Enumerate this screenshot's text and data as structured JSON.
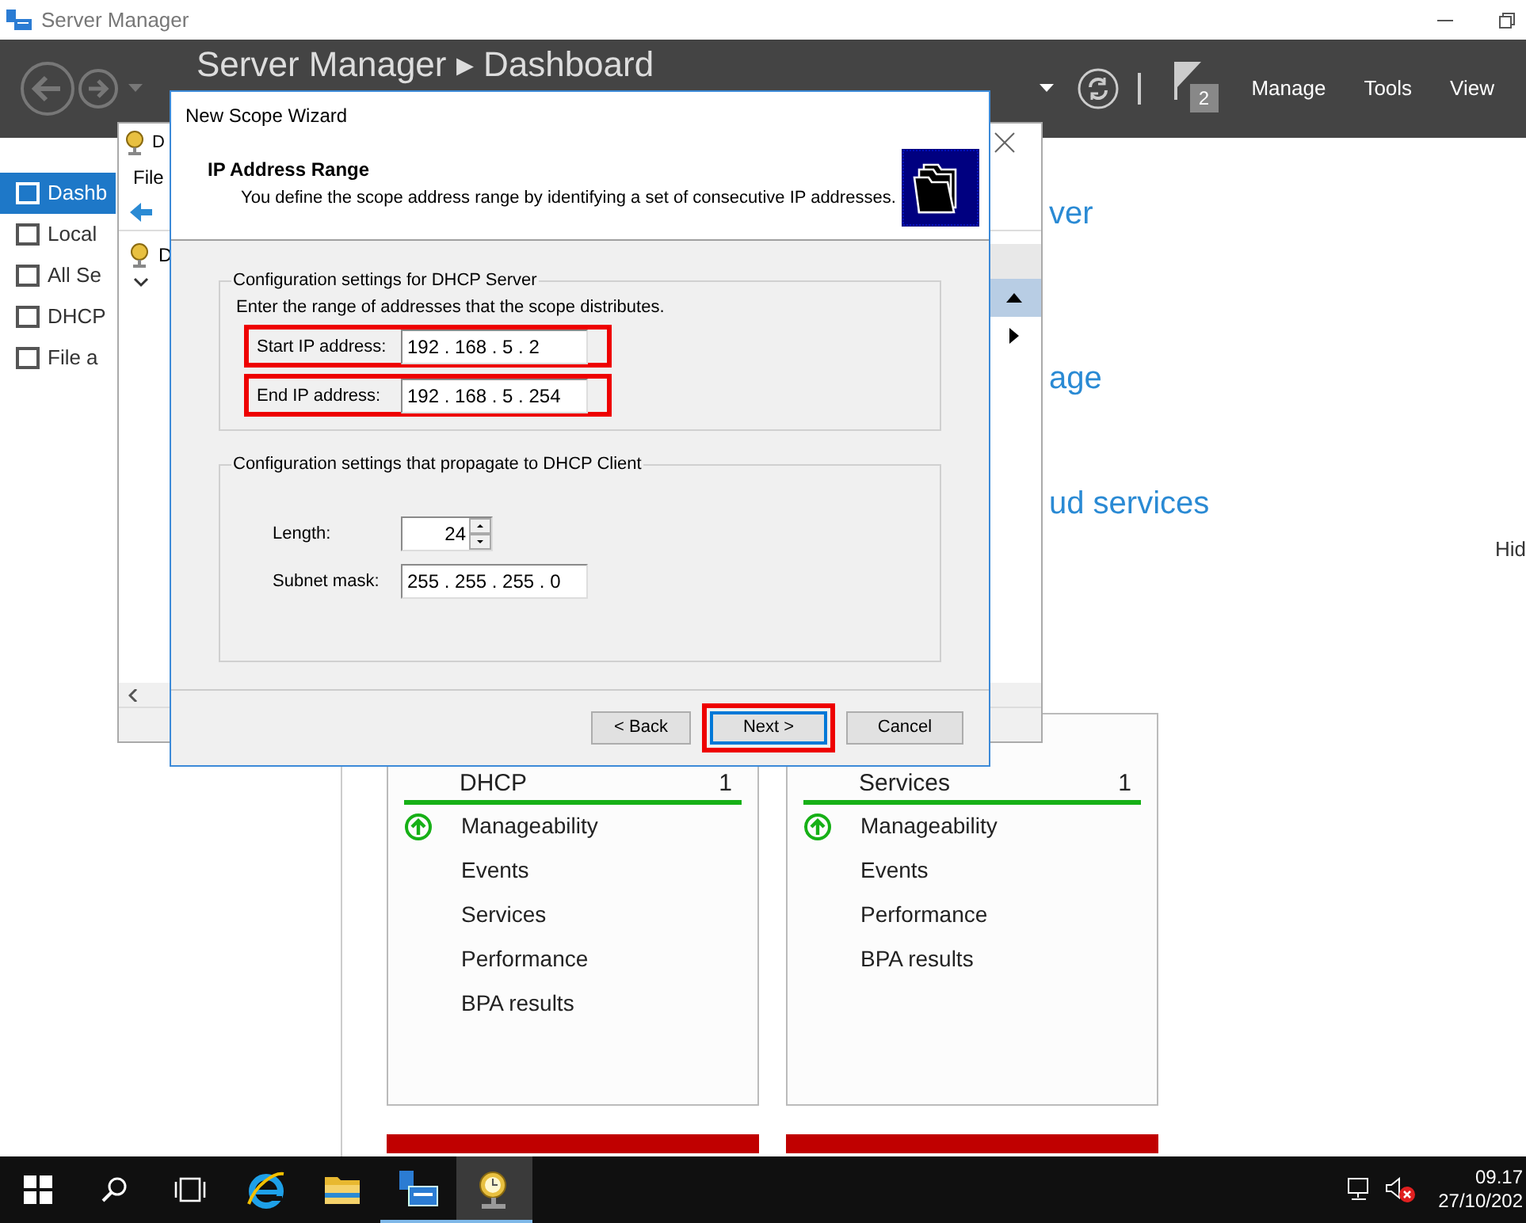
{
  "server_manager": {
    "title": "Server Manager",
    "breadcrumb": "Server Manager ▸ Dashboard",
    "notification_count": "2",
    "menu": [
      "Manage",
      "Tools",
      "View"
    ],
    "sidebar": [
      {
        "label": "Dashb",
        "selected": true
      },
      {
        "label": "Local",
        "selected": false
      },
      {
        "label": "All Se",
        "selected": false
      },
      {
        "label": "DHCP",
        "selected": false
      },
      {
        "label": "File a",
        "selected": false
      }
    ],
    "headings": [
      "ver",
      "age",
      "ud services"
    ],
    "hide_link": "Hid",
    "tiles": [
      {
        "title": "DHCP",
        "count": "1",
        "items": [
          {
            "label": "Manageability",
            "kind": "status"
          },
          {
            "label": "Events",
            "kind": "plain"
          },
          {
            "label": "Services",
            "kind": "plain"
          },
          {
            "label": "Performance",
            "kind": "plain"
          },
          {
            "label": "BPA results",
            "kind": "plain"
          }
        ]
      },
      {
        "title": "Services",
        "count": "1",
        "items": [
          {
            "label": "Manageability",
            "kind": "status"
          },
          {
            "label": "Events",
            "kind": "plain"
          },
          {
            "label": "Performance",
            "kind": "plain"
          },
          {
            "label": "BPA results",
            "kind": "plain"
          }
        ]
      }
    ]
  },
  "dhcp_console": {
    "title": "D",
    "menu": [
      "File"
    ],
    "tree_root": "D"
  },
  "wizard": {
    "title": "New Scope Wizard",
    "heading": "IP Address Range",
    "subtitle": "You define the scope address range by identifying a set of consecutive IP addresses.",
    "groups": [
      {
        "legend": "Configuration settings for DHCP Server",
        "intro": "Enter the range of addresses that the scope distributes.",
        "fields": [
          {
            "kind": "ip",
            "label": "Start IP address:",
            "value": "192 . 168 . 5 . 2",
            "highlighted": true
          },
          {
            "kind": "ip",
            "label": "End IP address:",
            "value": "192 . 168 . 5 . 254",
            "highlighted": true
          }
        ]
      },
      {
        "legend": "Configuration settings that propagate to DHCP Client",
        "fields": [
          {
            "kind": "spinner",
            "label": "Length:",
            "value": "24",
            "highlighted": false
          },
          {
            "kind": "ip",
            "label": "Subnet mask:",
            "value": "255 . 255 . 255 . 0",
            "highlighted": false
          }
        ]
      }
    ],
    "buttons": [
      {
        "label": "< Back",
        "default": false,
        "highlighted": false
      },
      {
        "label": "Next >",
        "default": true,
        "highlighted": true
      },
      {
        "label": "Cancel",
        "default": false,
        "highlighted": false
      }
    ]
  },
  "taskbar": {
    "buttons": [
      {
        "kind": "start"
      },
      {
        "kind": "search"
      },
      {
        "kind": "task-view"
      }
    ],
    "apps": [
      {
        "kind": "browser",
        "running": false,
        "active": false
      },
      {
        "kind": "explorer",
        "running": false,
        "active": false
      },
      {
        "kind": "server-manager",
        "running": true,
        "active": false
      },
      {
        "kind": "dhcp",
        "running": true,
        "active": true
      }
    ],
    "time": "09.17",
    "date": "27/10/202"
  }
}
